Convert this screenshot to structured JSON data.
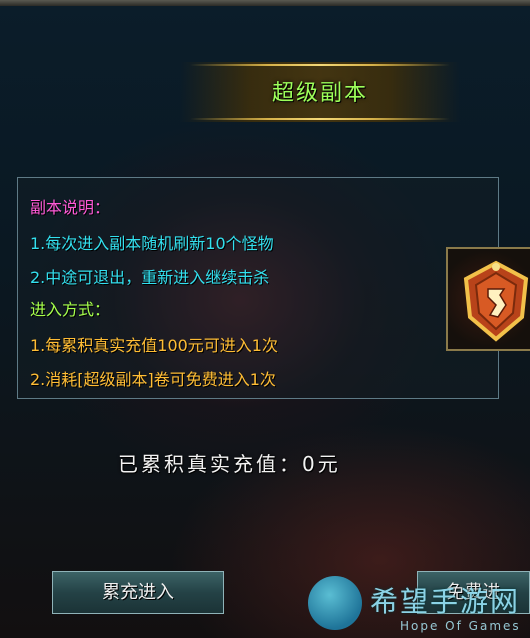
{
  "title": "超级副本",
  "panel": {
    "lines": [
      {
        "text": "副本说明：",
        "color": "magenta"
      },
      {
        "text": "1.每次进入副本随机刷新10个怪物",
        "color": "cyan"
      },
      {
        "text": "2.中途可退出，重新进入继续击杀",
        "color": "cyan"
      },
      {
        "text": "进入方式：",
        "color": "green"
      },
      {
        "text": "1.每累积真实充值100元可进入1次",
        "color": "orange"
      },
      {
        "text": "2.消耗[超级副本]卷可免费进入1次",
        "color": "orange"
      }
    ]
  },
  "accumulated_label": "已累积真实充值：0元",
  "buttons": {
    "recharge_enter": "累充进入",
    "free_enter": "免费进"
  },
  "watermark": {
    "main": "希望手游网",
    "sub": "Hope Of Games"
  },
  "colors": {
    "title_green": "#9dff5a",
    "magenta": "#ff5ad7",
    "cyan": "#33e0ef",
    "green": "#a6ff4c",
    "orange": "#ffbd35"
  },
  "icons": {
    "item_slot": "scroll-shield-icon",
    "watermark_logo": "hope-of-games-logo"
  }
}
